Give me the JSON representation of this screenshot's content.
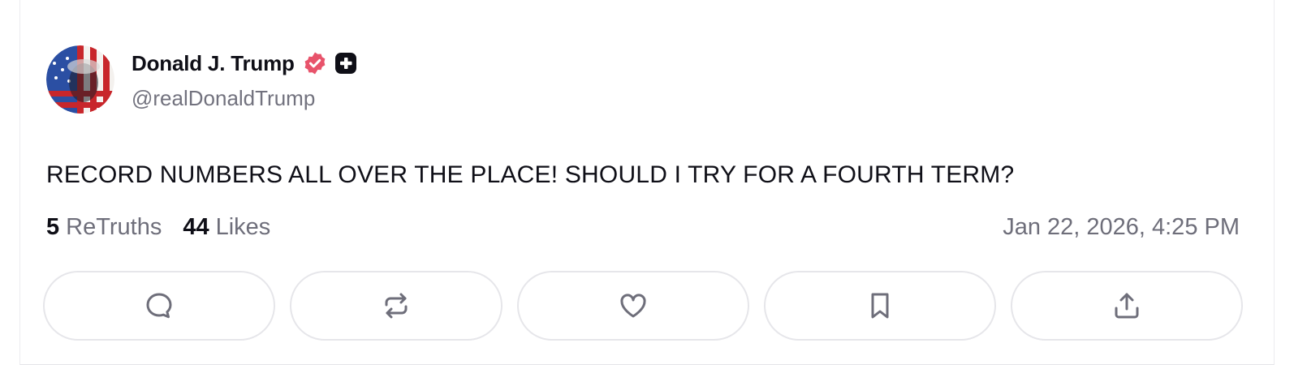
{
  "post": {
    "author": {
      "display_name": "Donald J. Trump",
      "handle": "@realDonaldTrump",
      "verified": true
    },
    "text": "RECORD NUMBERS ALL OVER THE PLACE! SHOULD I TRY FOR A FOURTH TERM?",
    "stats": {
      "retruths_count": "5",
      "retruths_label": "ReTruths",
      "likes_count": "44",
      "likes_label": "Likes"
    },
    "timestamp": "Jan 22, 2026, 4:25 PM"
  },
  "actions": [
    {
      "name": "reply",
      "icon": "comment-bubble-icon"
    },
    {
      "name": "retruth",
      "icon": "repost-arrows-icon"
    },
    {
      "name": "like",
      "icon": "heart-icon"
    },
    {
      "name": "bookmark",
      "icon": "bookmark-icon"
    },
    {
      "name": "share",
      "icon": "share-upload-icon"
    }
  ],
  "colors": {
    "verified_badge": "#e8536b",
    "text_primary": "#0f0f17",
    "text_secondary": "#6e6e7a",
    "button_border": "#e6e6ea"
  }
}
